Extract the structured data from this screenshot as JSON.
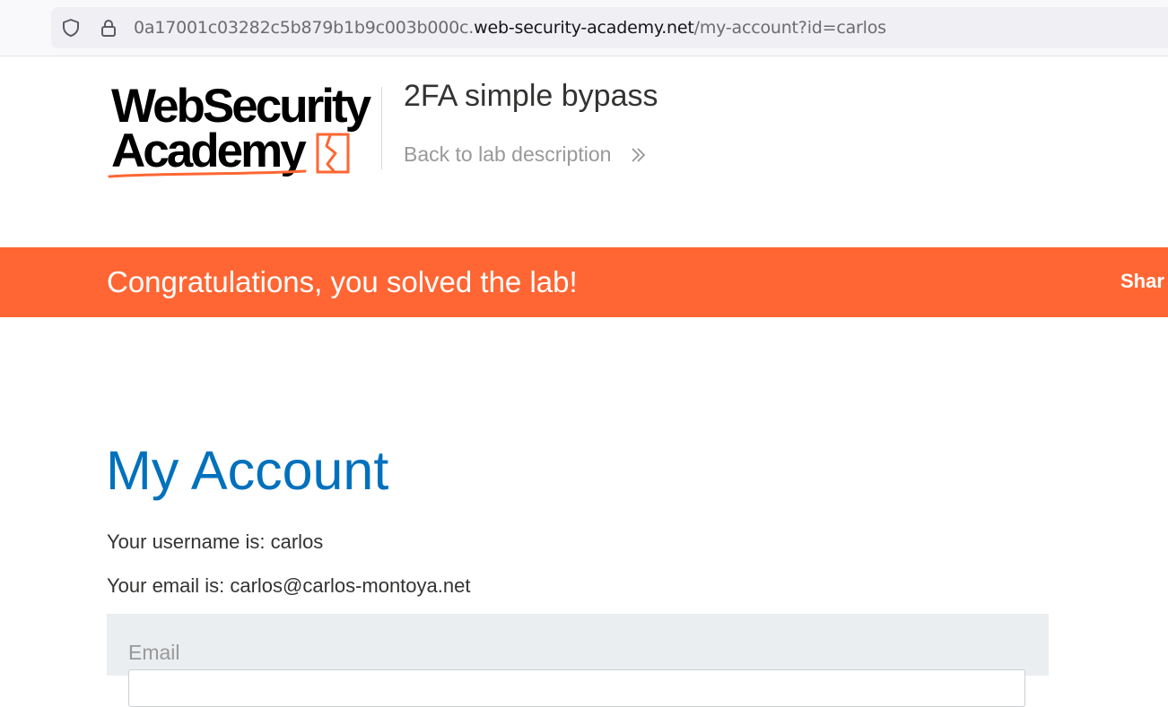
{
  "browser": {
    "url_prefix": "0a17001c03282c5b879b1b9c003b000c.",
    "url_domain": "web-security-academy.net",
    "url_path": "/my-account?id=carlos"
  },
  "header": {
    "logo_line1": "WebSecurity",
    "logo_line2": "Academy",
    "lab_title": "2FA simple bypass",
    "back_link": "Back to lab description"
  },
  "banner": {
    "message": "Congratulations, you solved the lab!",
    "share_label": "Shar",
    "color": "#ff6633"
  },
  "account": {
    "heading": "My Account",
    "username_line": "Your username is: carlos",
    "email_line": "Your email is: carlos@carlos-montoya.net",
    "email_form_label": "Email"
  },
  "colors": {
    "heading_blue": "#0071bc",
    "brand_orange": "#ff6633"
  },
  "icons": {
    "tracking_protection": "shield-icon",
    "connection": "lock-icon",
    "back": "double-chevron-right-icon",
    "logo_mark": "broken-box-icon"
  }
}
